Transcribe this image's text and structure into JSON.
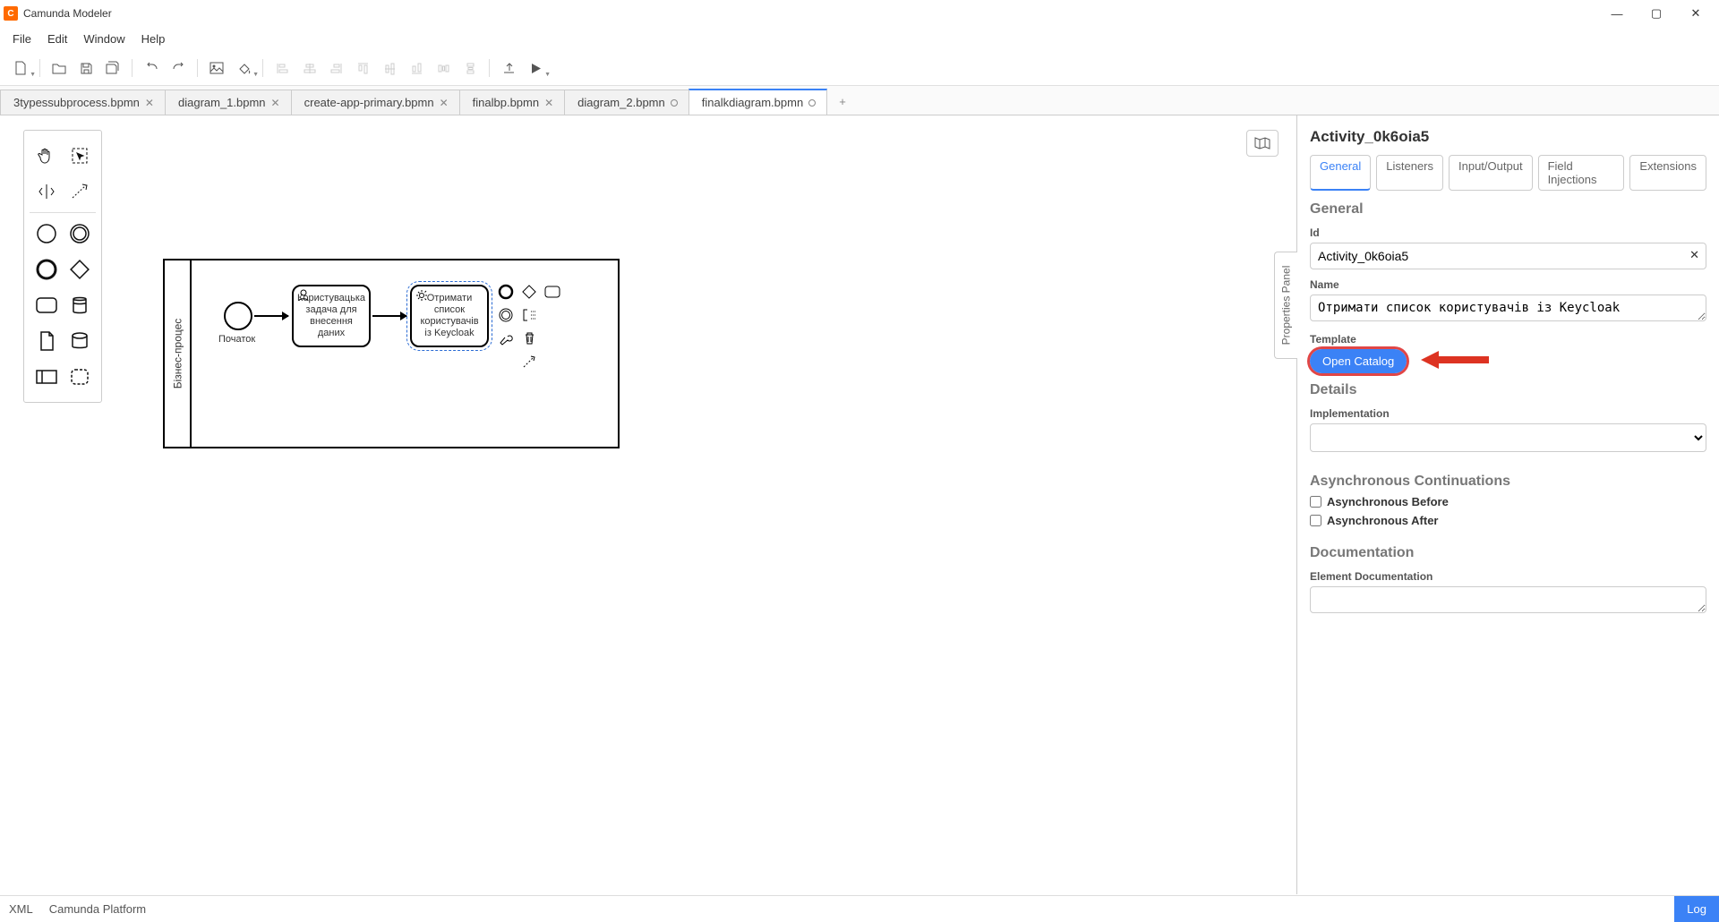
{
  "app": {
    "title": "Camunda Modeler"
  },
  "menu": {
    "file": "File",
    "edit": "Edit",
    "window": "Window",
    "help": "Help"
  },
  "tabs": {
    "items": [
      {
        "label": "3typessubprocess.bpmn",
        "dirty": false
      },
      {
        "label": "diagram_1.bpmn",
        "dirty": false
      },
      {
        "label": "create-app-primary.bpmn",
        "dirty": false
      },
      {
        "label": "finalbp.bpmn",
        "dirty": false
      },
      {
        "label": "diagram_2.bpmn",
        "dirty": true
      },
      {
        "label": "finalkdiagram.bpmn",
        "dirty": true
      }
    ],
    "active": 5
  },
  "diagram": {
    "pool_label": "Бізнес-процес",
    "start_label": "Початок",
    "task1": "Користувацька задача для внесення даних",
    "task2": "Отримати список користувачів із Keycloak"
  },
  "props": {
    "header": "Activity_0k6oia5",
    "tabs": {
      "general": "General",
      "listeners": "Listeners",
      "io": "Input/Output",
      "fi": "Field Injections",
      "ext": "Extensions"
    },
    "section_general": "General",
    "id_label": "Id",
    "id_value": "Activity_0k6oia5",
    "name_label": "Name",
    "name_value": "Отримати список користувачів із Keycloak",
    "template_label": "Template",
    "open_catalog": "Open Catalog",
    "section_details": "Details",
    "impl_label": "Implementation",
    "section_async": "Asynchronous Continuations",
    "async_before": "Asynchronous Before",
    "async_after": "Asynchronous After",
    "section_doc": "Documentation",
    "elem_doc_label": "Element Documentation",
    "panel_label": "Properties Panel"
  },
  "status": {
    "xml": "XML",
    "platform": "Camunda Platform",
    "log": "Log"
  }
}
